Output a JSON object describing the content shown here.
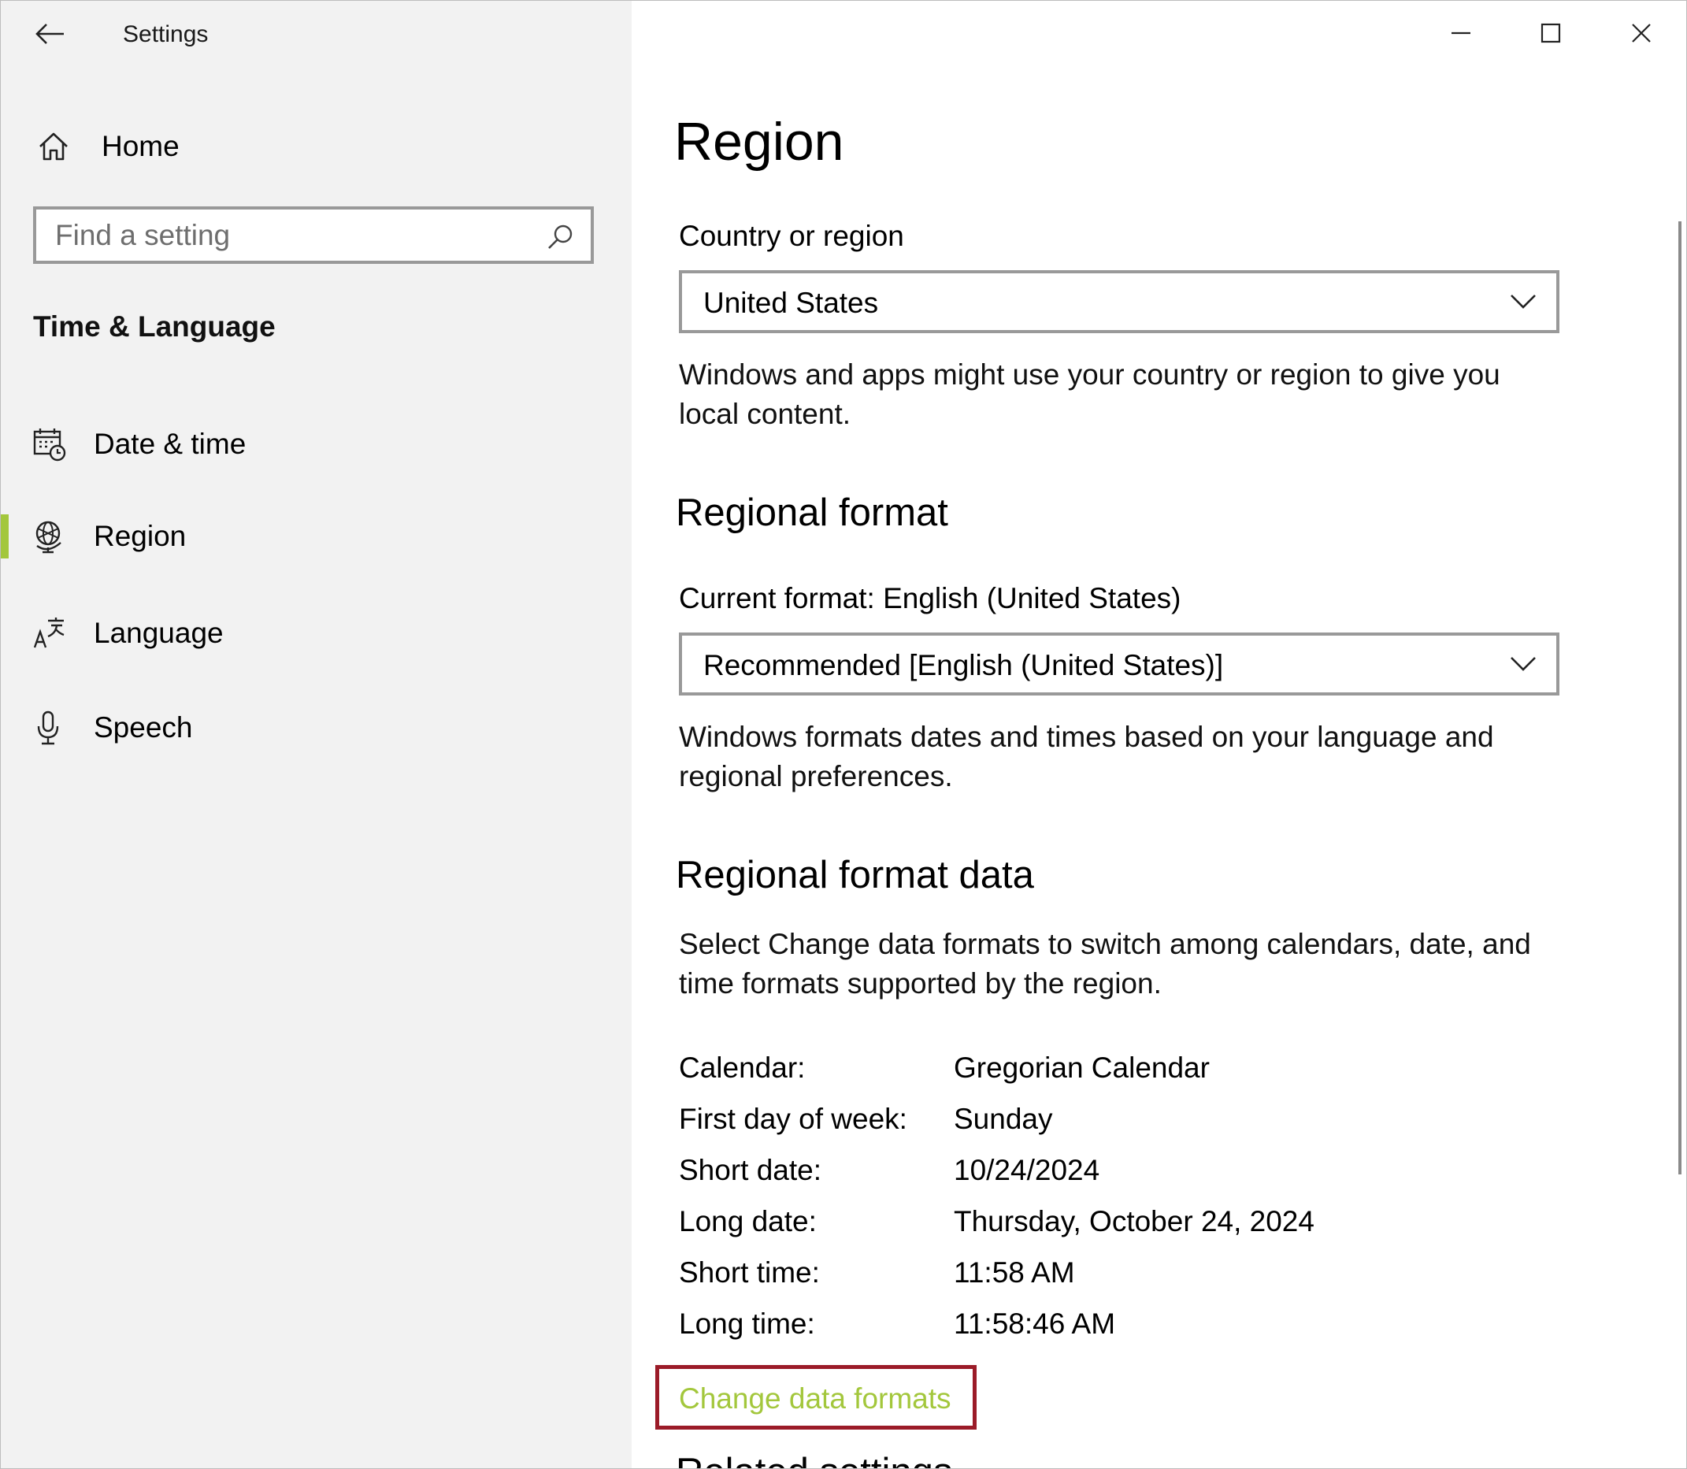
{
  "window": {
    "app_title": "Settings",
    "controls": [
      "minimize",
      "maximize",
      "close"
    ]
  },
  "sidebar": {
    "home_label": "Home",
    "search_placeholder": "Find a setting",
    "section_title": "Time & Language",
    "items": [
      {
        "label": "Date & time",
        "icon": "calendar-clock-icon"
      },
      {
        "label": "Region",
        "icon": "globe-icon",
        "active": true
      },
      {
        "label": "Language",
        "icon": "language-icon"
      },
      {
        "label": "Speech",
        "icon": "microphone-icon"
      }
    ],
    "accent_color": "#a3c73c"
  },
  "main": {
    "title": "Region",
    "country": {
      "label": "Country or region",
      "value": "United States",
      "description": "Windows and apps might use your country or region to give you local content."
    },
    "regional_format": {
      "heading": "Regional format",
      "current_label": "Current format: English (United States)",
      "value": "Recommended [English (United States)]",
      "description": "Windows formats dates and times based on your language and regional preferences."
    },
    "format_data": {
      "heading": "Regional format data",
      "description": "Select Change data formats to switch among calendars, date, and time formats supported by the region.",
      "rows": [
        {
          "key": "Calendar:",
          "value": "Gregorian Calendar"
        },
        {
          "key": "First day of week:",
          "value": "Sunday"
        },
        {
          "key": "Short date:",
          "value": "10/24/2024"
        },
        {
          "key": "Long date:",
          "value": "Thursday, October 24, 2024"
        },
        {
          "key": "Short time:",
          "value": "11:58 AM"
        },
        {
          "key": "Long time:",
          "value": "11:58:46 AM"
        }
      ],
      "change_link": "Change data formats",
      "highlight_color": "#9b1b28"
    },
    "related_heading": "Related settings"
  }
}
